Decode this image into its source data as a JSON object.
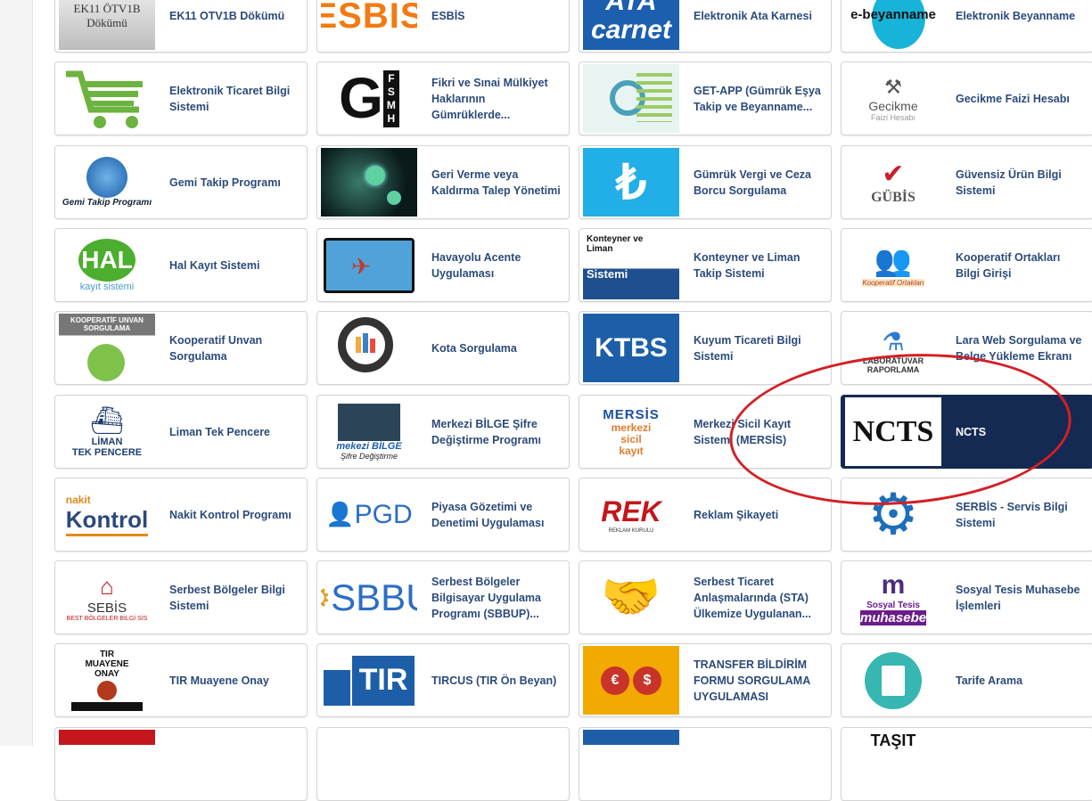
{
  "colors": {
    "label_text": "#2c4a7a",
    "tile_border": "#d4d4d4",
    "active_tile_bg": "#142a52",
    "annotation_red": "#d41f26"
  },
  "tiles": [
    {
      "label": "EK11 OTV1B Dökümü",
      "logo": "ek11-otv1b-logo",
      "logo_text": "EK11 ÖTV1B Dökümü"
    },
    {
      "label": "ESBİS",
      "logo": "esbis-logo",
      "logo_text": "ESBIS"
    },
    {
      "label": "Elektronik Ata Karnesi",
      "logo": "ata-carnet-logo",
      "logo_text": "ATA carnet"
    },
    {
      "label": "Elektronik Beyanname",
      "logo": "e-beyanname-logo",
      "logo_text": "e-beyanname"
    },
    {
      "label": "Elektronik Ticaret Bilgi Sistemi",
      "logo": "shopping-cart-icon",
      "logo_text": ""
    },
    {
      "label": "Fikri ve Sınai Mülkiyet Haklarının Gümrüklerde...",
      "logo": "gfsmh-logo",
      "logo_text": "G FSMH"
    },
    {
      "label": "GET-APP (Gümrük Eşya Takip ve Beyanname...",
      "logo": "get-app-logo",
      "logo_text": ""
    },
    {
      "label": "Gecikme Faizi Hesabı",
      "logo": "gecikme-faizi-logo",
      "logo_text": "Gecikme Faizi Hesabı"
    },
    {
      "label": "Gemi Takip Programı",
      "logo": "gemi-takip-logo",
      "logo_text": "Gemi Takip Programı"
    },
    {
      "label": "Geri Verme veya Kaldırma Talep Yönetimi",
      "logo": "virus-image",
      "logo_text": ""
    },
    {
      "label": "Gümrük Vergi ve Ceza Borcu Sorgulama",
      "logo": "lira-icon",
      "logo_text": "₺"
    },
    {
      "label": "Güvensiz Ürün Bilgi Sistemi",
      "logo": "gubis-logo",
      "logo_text": "GÜBİS"
    },
    {
      "label": "Hal Kayıt Sistemi",
      "logo": "hal-kayit-logo",
      "logo_text": "HAL kayıt sistemi"
    },
    {
      "label": "Havayolu Acente Uygulaması",
      "logo": "airline-ticket-icon",
      "logo_text": ""
    },
    {
      "label": "Konteyner ve Liman Takip Sistemi",
      "logo": "konteyner-takip-logo",
      "logo_text": "Konteyner ve Liman Takip Sistemi"
    },
    {
      "label": "Kooperatif Ortakları Bilgi Girişi",
      "logo": "kooperatif-ortaklari-logo",
      "logo_text": "Kooperatif Ortakları Bilgi Girişi"
    },
    {
      "label": "Kooperatif Unvan Sorgulama",
      "logo": "kooperatif-unvan-logo",
      "logo_text": "KOOPERATİF UNVAN SORGULAMA"
    },
    {
      "label": "Kota Sorgulama",
      "logo": "kota-chart-icon",
      "logo_text": ""
    },
    {
      "label": "Kuyum Ticareti Bilgi Sistemi",
      "logo": "ktbs-logo",
      "logo_text": "KTBS"
    },
    {
      "label": "Lara Web Sorgulama ve Belge Yükleme Ekranı",
      "logo": "laboratuvar-logo",
      "logo_text": "LABORATUVAR RAPORLAMA"
    },
    {
      "label": "Liman Tek Pencere",
      "logo": "liman-tek-pencere-logo",
      "logo_text": "LİMAN TEK PENCERE"
    },
    {
      "label": "Merkezi BİLGE Şifre Değiştirme Programı",
      "logo": "merkezi-bilge-logo",
      "logo_text": "mekezi BİLGE Şifre Değiştirme"
    },
    {
      "label": "Merkezi Sicil Kayıt Sistemi (MERSİS)",
      "logo": "mersis-logo",
      "logo_text": "MERSİS merkezi sicil kayıt sistemi"
    },
    {
      "label": "NCTS",
      "logo": "ncts-logo",
      "logo_text": "NCTS",
      "active": true
    },
    {
      "label": "Nakit Kontrol Programı",
      "logo": "nakit-kontrol-logo",
      "logo_text": "nakit Kontrol"
    },
    {
      "label": "Piyasa Gözetimi ve Denetimi Uygulaması",
      "logo": "pgd-logo",
      "logo_text": "PGD"
    },
    {
      "label": "Reklam Şikayeti",
      "logo": "rek-logo",
      "logo_text": "REK"
    },
    {
      "label": "SERBİS - Servis Bilgi Sistemi",
      "logo": "serbis-gear-logo",
      "logo_text": ""
    },
    {
      "label": "Serbest Bölgeler Bilgi Sistemi",
      "logo": "sebis-logo",
      "logo_text": "SEBİS"
    },
    {
      "label": "Serbest Bölgeler Bilgisayar Uygulama Programı (SBBUP)...",
      "logo": "sbbup-logo",
      "logo_text": "SBBU"
    },
    {
      "label": "Serbest Ticaret Anlaşmalarında (STA) Ülkemize Uygulanan...",
      "logo": "handshake-icon",
      "logo_text": ""
    },
    {
      "label": "Sosyal Tesis Muhasebe İşlemleri",
      "logo": "sosyal-tesis-logo",
      "logo_text": "Sosyal Tesis muhasebe"
    },
    {
      "label": "TIR Muayene Onay",
      "logo": "tir-muayene-logo",
      "logo_text": "TIR MUAYENE ONAY"
    },
    {
      "label": "TIRCUS (TIR Ön Beyan)",
      "logo": "tircus-truck-logo",
      "logo_text": "TIR"
    },
    {
      "label": "TRANSFER BİLDİRİM FORMU SORGULAMA UYGULAMASI",
      "logo": "transfer-euro-dollar-logo",
      "logo_text": "€ $"
    },
    {
      "label": "Tarife Arama",
      "logo": "tarife-document-icon",
      "logo_text": ""
    },
    {
      "label": "",
      "logo": "partial-red-logo",
      "logo_text": ""
    },
    {
      "label": "",
      "logo": "partial-logo",
      "logo_text": ""
    },
    {
      "label": "",
      "logo": "partial-blue-logo",
      "logo_text": ""
    },
    {
      "label": "",
      "logo": "tasit-logo",
      "logo_text": "TAŞIT"
    }
  ]
}
